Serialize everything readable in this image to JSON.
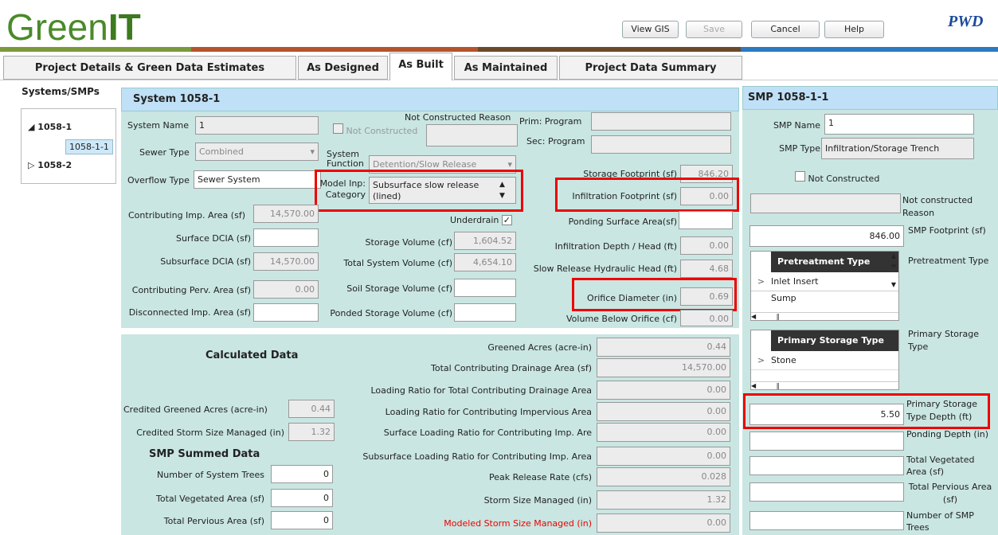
{
  "app": {
    "logo_text_1": "Green",
    "logo_text_2": "IT",
    "pwd_logo": "PWD"
  },
  "toolbar": {
    "view_gis": "View GIS",
    "save": "Save",
    "cancel": "Cancel",
    "help": "Help"
  },
  "tabs": [
    "Project Details & Green Data Estimates",
    "As Designed",
    "As Built",
    "As Maintained",
    "Project Data Summary"
  ],
  "tree": {
    "title": "Systems/SMPs",
    "nodes": [
      "1058-1",
      "1058-1-1",
      "1058-2"
    ]
  },
  "system": {
    "title": "System 1058-1",
    "system_name_label": "System Name",
    "system_name": "1",
    "not_constructed": "Not Constructed",
    "not_constructed_reason_label": "Not Constructed Reason",
    "prim_program_label": "Prim: Program",
    "sec_program_label": "Sec: Program",
    "sewer_type_label": "Sewer Type",
    "sewer_type": "Combined",
    "system_function_label": "System Function",
    "system_function": "Detention/Slow Release",
    "overflow_type_label": "Overflow Type",
    "overflow_type": "Sewer System",
    "model_inp_label": "Model Inp: Category",
    "model_inp": "Subsurface slow release (lined)",
    "storage_footprint_label": "Storage Footprint (sf)",
    "storage_footprint": "846.20",
    "infiltration_footprint_label": "Infiltration Footprint (sf)",
    "infiltration_footprint": "0.00",
    "contrib_imp_label": "Contributing Imp. Area (sf)",
    "contrib_imp": "14,570.00",
    "underdrain_label": "Underdrain",
    "underdrain_check": "✓",
    "ponding_surface_label": "Ponding Surface Area(sf)",
    "ponding_surface": "",
    "surface_dcia_label": "Surface DCIA (sf)",
    "surface_dcia": "",
    "storage_volume_label": "Storage Volume (cf)",
    "storage_volume": "1,604.52",
    "infiltration_depth_label": "Infiltration Depth / Head (ft)",
    "infiltration_depth": "0.00",
    "subsurface_dcia_label": "Subsurface DCIA (sf)",
    "subsurface_dcia": "14,570.00",
    "total_system_volume_label": "Total System Volume (cf)",
    "total_system_volume": "4,654.10",
    "slow_release_head_label": "Slow Release Hydraulic Head (ft)",
    "slow_release_head": "4.68",
    "contrib_perv_label": "Contributing Perv. Area (sf)",
    "contrib_perv": "0.00",
    "soil_storage_label": "Soil Storage Volume (cf)",
    "soil_storage": "",
    "orifice_diameter_label": "Orifice Diameter (in)",
    "orifice_diameter": "0.69",
    "disconnected_label": "Disconnected Imp. Area (sf)",
    "disconnected": "",
    "ponded_storage_label": "Ponded Storage Volume (cf)",
    "ponded_storage": "",
    "volume_below_label": "Volume Below Orifice (cf)",
    "volume_below": "0.00"
  },
  "calc": {
    "title": "Calculated Data",
    "credited_greened_label": "Credited Greened Acres (acre-in)",
    "credited_greened": "0.44",
    "credited_storm_label": "Credited Storm Size Managed (in)",
    "credited_storm": "1.32",
    "smp_summed_title": "SMP Summed Data",
    "num_trees_label": "Number of System Trees",
    "num_trees": "0",
    "total_veg_label": "Total Vegetated Area (sf)",
    "total_veg": "0",
    "total_perv_label": "Total Pervious Area (sf)",
    "total_perv": "0",
    "rows": [
      {
        "label": "Greened Acres (acre-in)",
        "value": "0.44",
        "red": false
      },
      {
        "label": "Total Contributing Drainage Area (sf)",
        "value": "14,570.00",
        "red": false
      },
      {
        "label": "Loading Ratio for Total Contributing Drainage Area",
        "value": "0.00",
        "red": false
      },
      {
        "label": "Loading Ratio for Contributing Impervious Area",
        "value": "0.00",
        "red": false
      },
      {
        "label": "Surface Loading Ratio for Contributing Imp. Are",
        "value": "0.00",
        "red": false
      },
      {
        "label": "Subsurface Loading Ratio for Contributing Imp. Area",
        "value": "0.00",
        "red": false
      },
      {
        "label": "Peak Release Rate (cfs)",
        "value": "0.028",
        "red": false
      },
      {
        "label": "Storm Size Managed (in)",
        "value": "1.32",
        "red": false
      },
      {
        "label": "Modeled Storm Size Managed (in)",
        "value": "0.00",
        "red": true
      }
    ]
  },
  "smp": {
    "title": "SMP 1058-1-1",
    "smp_name_label": "SMP Name",
    "smp_name": "1",
    "smp_type_label": "SMP Type",
    "smp_type": "Infiltration/Storage Trench",
    "not_constructed": "Not Constructed",
    "not_constructed_reason_label": "Not constructed Reason",
    "footprint_label": "SMP Footprint (sf)",
    "footprint": "846.00",
    "pretreatment_label": "Pretreatment Type",
    "pretreatment_header": "Pretreatment Type",
    "pretreatment_items": [
      "Inlet Insert",
      "Sump"
    ],
    "primary_storage_label": "Primary Storage Type",
    "primary_storage_header": "Primary Storage Type",
    "primary_storage_items": [
      "Stone"
    ],
    "primary_depth_label": "Primary Storage Type Depth (ft)",
    "primary_depth": "5.50",
    "ponding_depth_label": "Ponding Depth (in)",
    "total_veg_label": "Total Vegetated Area (sf)",
    "total_perv_label": "Total Pervious Area (sf)",
    "num_trees_label": "Number of SMP Trees"
  }
}
